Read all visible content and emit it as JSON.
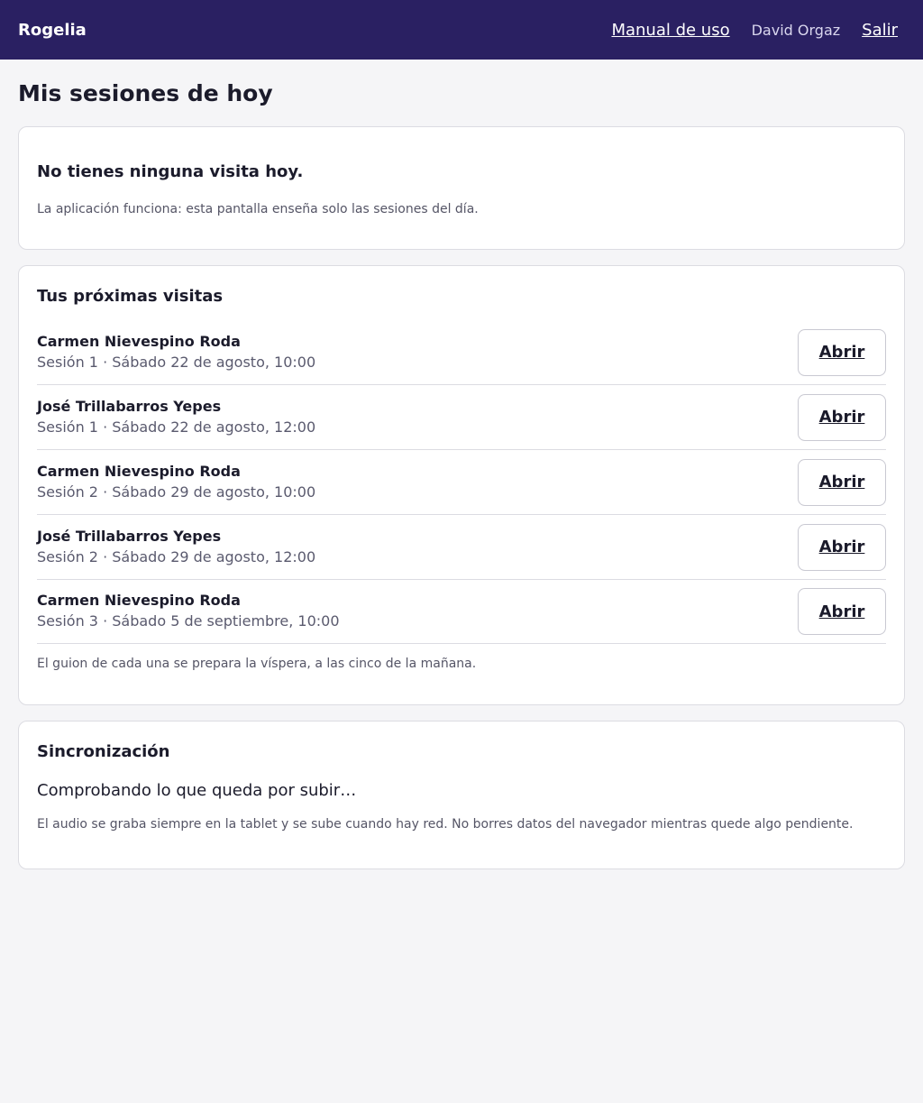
{
  "header": {
    "brand": "Rogelia",
    "manual_label": "Manual de uso",
    "user_name": "David Orgaz",
    "logout_label": "Salir",
    "bg_color": "#2a2062"
  },
  "page": {
    "title": "Mis sesiones de hoy"
  },
  "today": {
    "title": "No tienes ninguna visita hoy.",
    "note": "La aplicación funciona: esta pantalla enseña solo las sesiones del día."
  },
  "upcoming": {
    "title": "Tus próximas visitas",
    "open_label": "Abrir",
    "items": [
      {
        "name": "Carmen Nievespino Roda",
        "meta": "Sesión 1 · Sábado 22 de agosto, 10:00"
      },
      {
        "name": "José Trillabarros Yepes",
        "meta": "Sesión 1 · Sábado 22 de agosto, 12:00"
      },
      {
        "name": "Carmen Nievespino Roda",
        "meta": "Sesión 2 · Sábado 29 de agosto, 10:00"
      },
      {
        "name": "José Trillabarros Yepes",
        "meta": "Sesión 2 · Sábado 29 de agosto, 12:00"
      },
      {
        "name": "Carmen Nievespino Roda",
        "meta": "Sesión 3 · Sábado 5 de septiembre, 10:00"
      }
    ],
    "note": "El guion de cada una se prepara la víspera, a las cinco de la mañana."
  },
  "sync": {
    "title": "Sincronización",
    "status": "Comprobando lo que queda por subir…",
    "note": "El audio se graba siempre en la tablet y se sube cuando hay red. No borres datos del navegador mientras quede algo pendiente."
  }
}
